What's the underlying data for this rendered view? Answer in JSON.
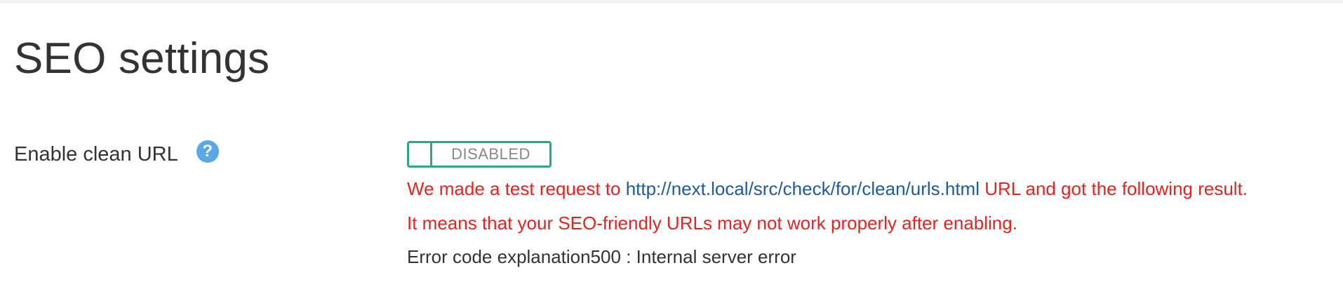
{
  "page": {
    "title": "SEO settings"
  },
  "field": {
    "label": "Enable clean URL",
    "help_icon": "question-circle-icon",
    "help_glyph": "?"
  },
  "toggle": {
    "state_label": "DISABLED",
    "enabled": false,
    "accent_color": "#2aa88c"
  },
  "message": {
    "line1_prefix": "We made a test request to ",
    "line1_url": "http://next.local/src/check/for/clean/urls.html",
    "line1_suffix": " URL and got the following result.",
    "line2": "It means that your SEO-friendly URLs may not work properly after enabling.",
    "line3": "Error code explanation500 : Internal server error",
    "error_color": "#e8231f",
    "link_color": "#1f5b9c"
  }
}
